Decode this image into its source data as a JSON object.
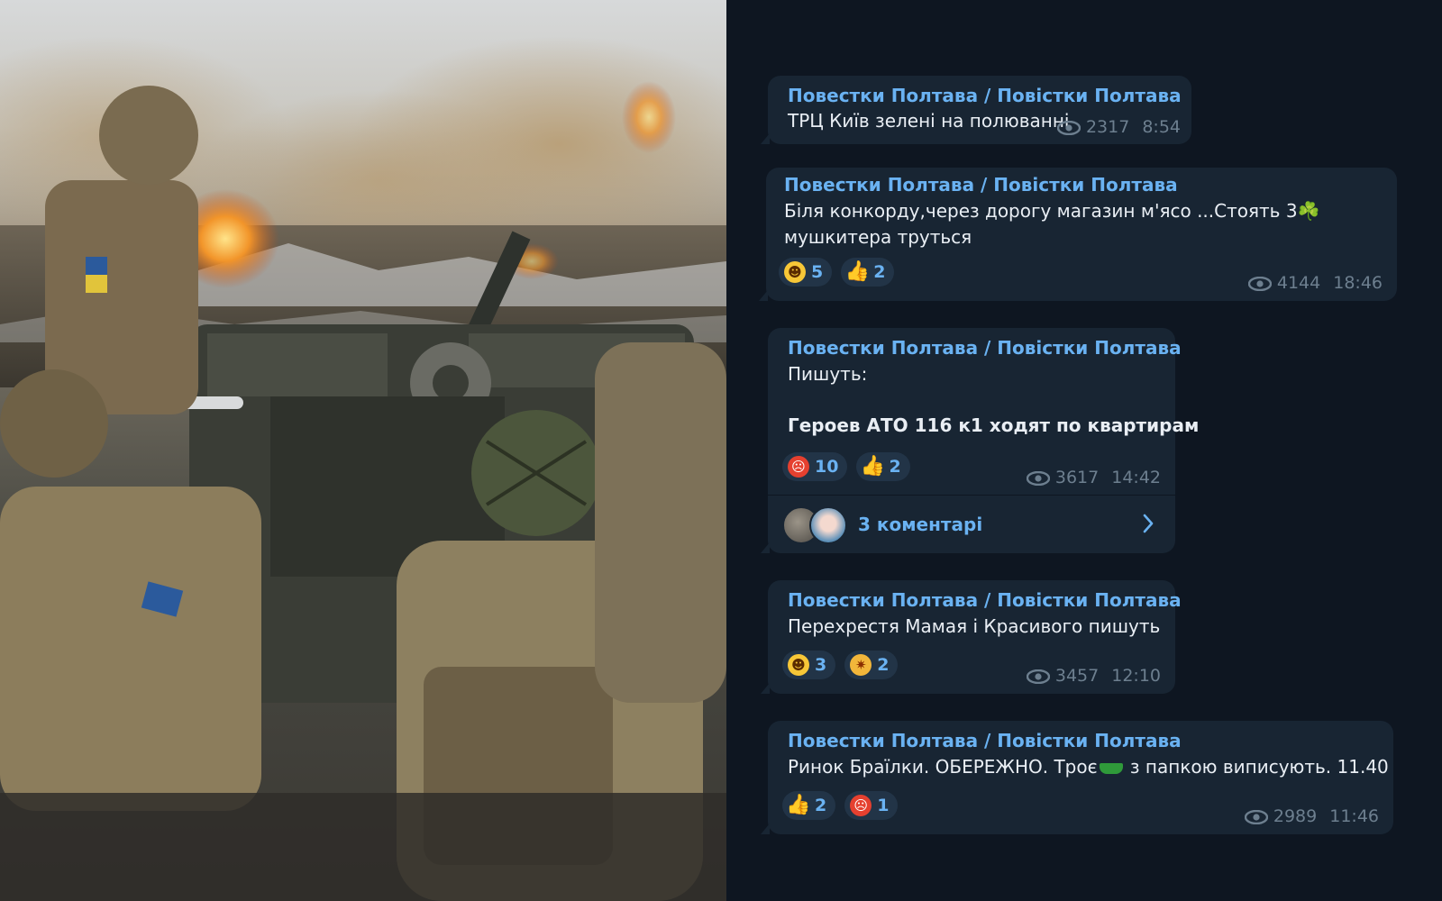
{
  "channel": {
    "name": "Повестки Полтава / Повістки Полтава",
    "colors": {
      "background": "#0e1621",
      "bubble": "#182533",
      "author": "#6ab2f2",
      "meta": "#6d7f8f"
    }
  },
  "photo": {
    "description_icon": "artillery-crew-photo"
  },
  "messages": [
    {
      "author": "Повестки Полтава / Повістки Полтава",
      "text_lines": [
        "ТРЦ Київ зелені на полюванні"
      ],
      "views": "2317",
      "time": "8:54",
      "reactions": []
    },
    {
      "author": "Повестки Полтава / Повістки Полтава",
      "text_lines": [
        "Біля конкорду,через дорогу магазин м'ясо ...Стоять 3☘️",
        "мушкитера труться"
      ],
      "views": "4144",
      "time": "18:46",
      "reactions": [
        {
          "emoji": "grin-icon",
          "count": "5"
        },
        {
          "emoji": "thumbs-up-icon",
          "count": "2"
        }
      ]
    },
    {
      "author": "Повестки Полтава / Повістки Полтава",
      "text_lines": [
        "Пишуть:",
        "Героев АТО 116 к1 ходят по квартирам"
      ],
      "views": "3617",
      "time": "14:42",
      "reactions": [
        {
          "emoji": "angry-face-icon",
          "count": "10"
        },
        {
          "emoji": "thumbs-up-icon",
          "count": "2"
        }
      ],
      "comments": "3 коментарі"
    },
    {
      "author": "Повестки Полтава / Повістки Полтава",
      "text_lines": [
        "Перехрестя Мамая і Красивого пишуть"
      ],
      "views": "3457",
      "time": "12:10",
      "reactions": [
        {
          "emoji": "grin-icon",
          "count": "3"
        },
        {
          "emoji": "exploding-head-icon",
          "count": "2"
        }
      ]
    },
    {
      "author": "Повестки Полтава / Повістки Полтава",
      "text_before_emoji": "Ринок Браїлки. ОБЕРЕЖНО. Троє",
      "text_after_emoji": " з папкою виписують. 11.40",
      "views": "2989",
      "time": "11:46",
      "reactions": [
        {
          "emoji": "thumbs-up-icon",
          "count": "2"
        },
        {
          "emoji": "angry-face-icon",
          "count": "1"
        }
      ]
    }
  ]
}
